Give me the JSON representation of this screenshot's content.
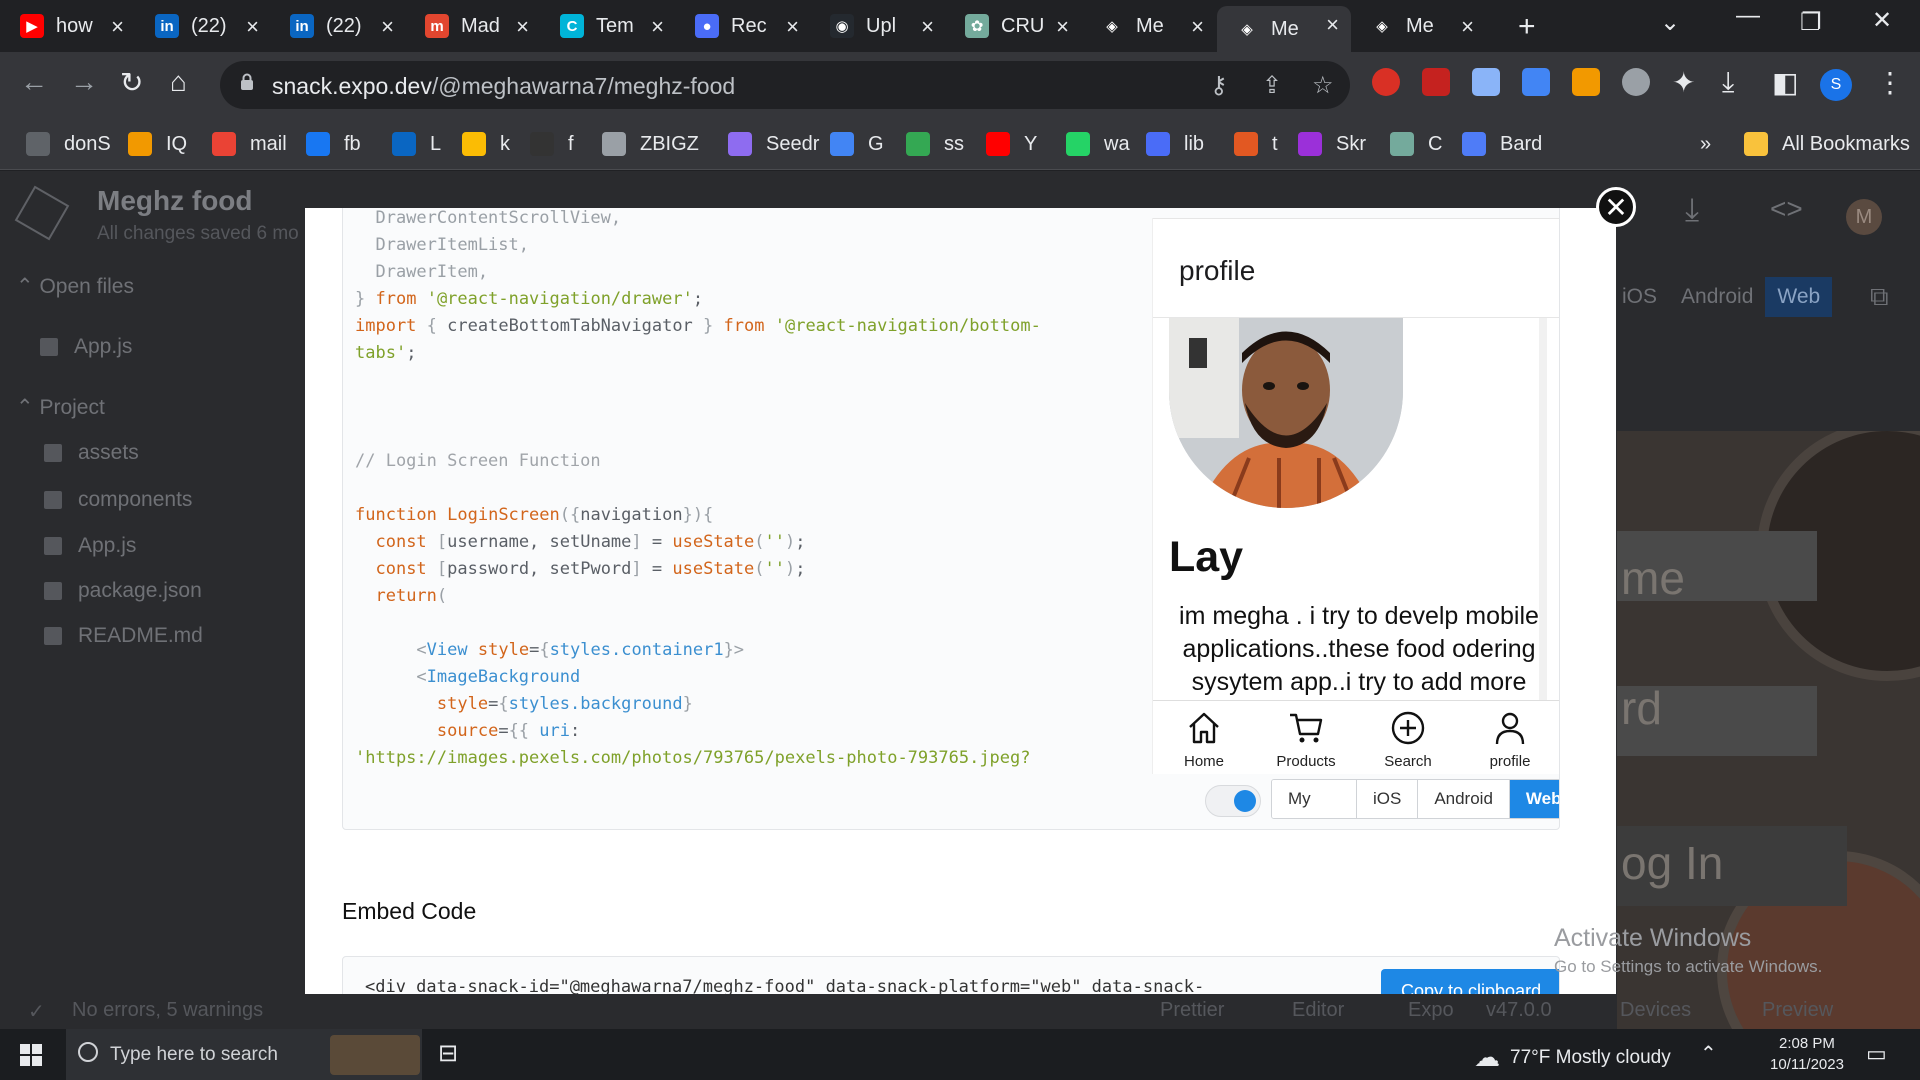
{
  "browser": {
    "tabs": [
      {
        "label": "how",
        "icon": "youtube-icon",
        "color": "#ff0000"
      },
      {
        "label": "(22)",
        "icon": "linkedin-icon",
        "color": "#0a66c2"
      },
      {
        "label": "(22)",
        "icon": "linkedin-icon",
        "color": "#0a66c2"
      },
      {
        "label": "Mad",
        "icon": "m-brand-icon",
        "color": "#e2462f"
      },
      {
        "label": "Tem",
        "icon": "canva-icon",
        "color": "#00b4d8"
      },
      {
        "label": "Rec",
        "icon": "recorder-icon",
        "color": "#4a6cf7"
      },
      {
        "label": "Upl",
        "icon": "github-icon",
        "color": "#24292f"
      },
      {
        "label": "CRU",
        "icon": "chatgpt-icon",
        "color": "#74aa9c"
      },
      {
        "label": "Me",
        "icon": "expo-snack-icon",
        "color": "#ffffff"
      },
      {
        "label": "Me",
        "icon": "expo-snack-icon",
        "color": "#ffffff",
        "active": true
      },
      {
        "label": "Me",
        "icon": "expo-snack-icon",
        "color": "#ffffff"
      }
    ],
    "url_host": "snack.expo.dev",
    "url_path": "/@meghawarna7/meghz-food",
    "profile_initial": "S",
    "bookmarks": [
      {
        "label": "donS"
      },
      {
        "label": "IQ"
      },
      {
        "label": "mail"
      },
      {
        "label": "fb"
      },
      {
        "label": "L"
      },
      {
        "label": "k"
      },
      {
        "label": "f"
      },
      {
        "label": "ZBIGZ"
      },
      {
        "label": "Seedr"
      },
      {
        "label": "G"
      },
      {
        "label": "ss"
      },
      {
        "label": "Y"
      },
      {
        "label": "wa"
      },
      {
        "label": "lib"
      },
      {
        "label": "t"
      },
      {
        "label": "Skr"
      },
      {
        "label": "C"
      },
      {
        "label": "Bard"
      }
    ],
    "all_bookmarks": "All Bookmarks"
  },
  "app": {
    "project_title": "Meghz food",
    "saved_status": "All changes saved 6 mo",
    "open_files_label": "Open files",
    "open_file": "App.js",
    "project_label": "Project",
    "files": [
      "assets",
      "components",
      "App.js",
      "package.json",
      "README.md"
    ],
    "platforms": [
      "iOS",
      "Android",
      "Web"
    ],
    "avatar_initial": "M",
    "status": "No errors, 5 warnings",
    "footer_items": [
      "Prettier",
      "Editor",
      "Expo",
      "v47.0.0",
      "Devices",
      "Preview"
    ],
    "preview_words": [
      "me",
      "rd",
      "og In"
    ]
  },
  "modal": {
    "phone": {
      "header": "profile",
      "name": "Lay",
      "bio": "im megha . i try to develp mobile applications..these food odering sysytem app..i try to add more",
      "tabs": [
        {
          "label": "Home",
          "icon": "home-icon"
        },
        {
          "label": "Products",
          "icon": "cart-icon"
        },
        {
          "label": "Search",
          "icon": "plus-circle-icon"
        },
        {
          "label": "profile",
          "icon": "person-icon"
        }
      ]
    },
    "platform_options": [
      "My Device",
      "iOS",
      "Android",
      "Web"
    ],
    "selected_platform": "Web",
    "embed_title": "Embed Code",
    "embed_code": "<div data-snack-id=\"@meghawarna7/meghz-food\" data-snack-platform=\"web\" data-snack-",
    "copy_button": "Copy to clipboard"
  },
  "os": {
    "activate_title": "Activate Windows",
    "activate_sub": "Go to Settings to activate Windows.",
    "search_placeholder": "Type here to search",
    "weather": "77°F  Mostly cloudy",
    "time": "2:08 PM",
    "date": "10/11/2023"
  }
}
